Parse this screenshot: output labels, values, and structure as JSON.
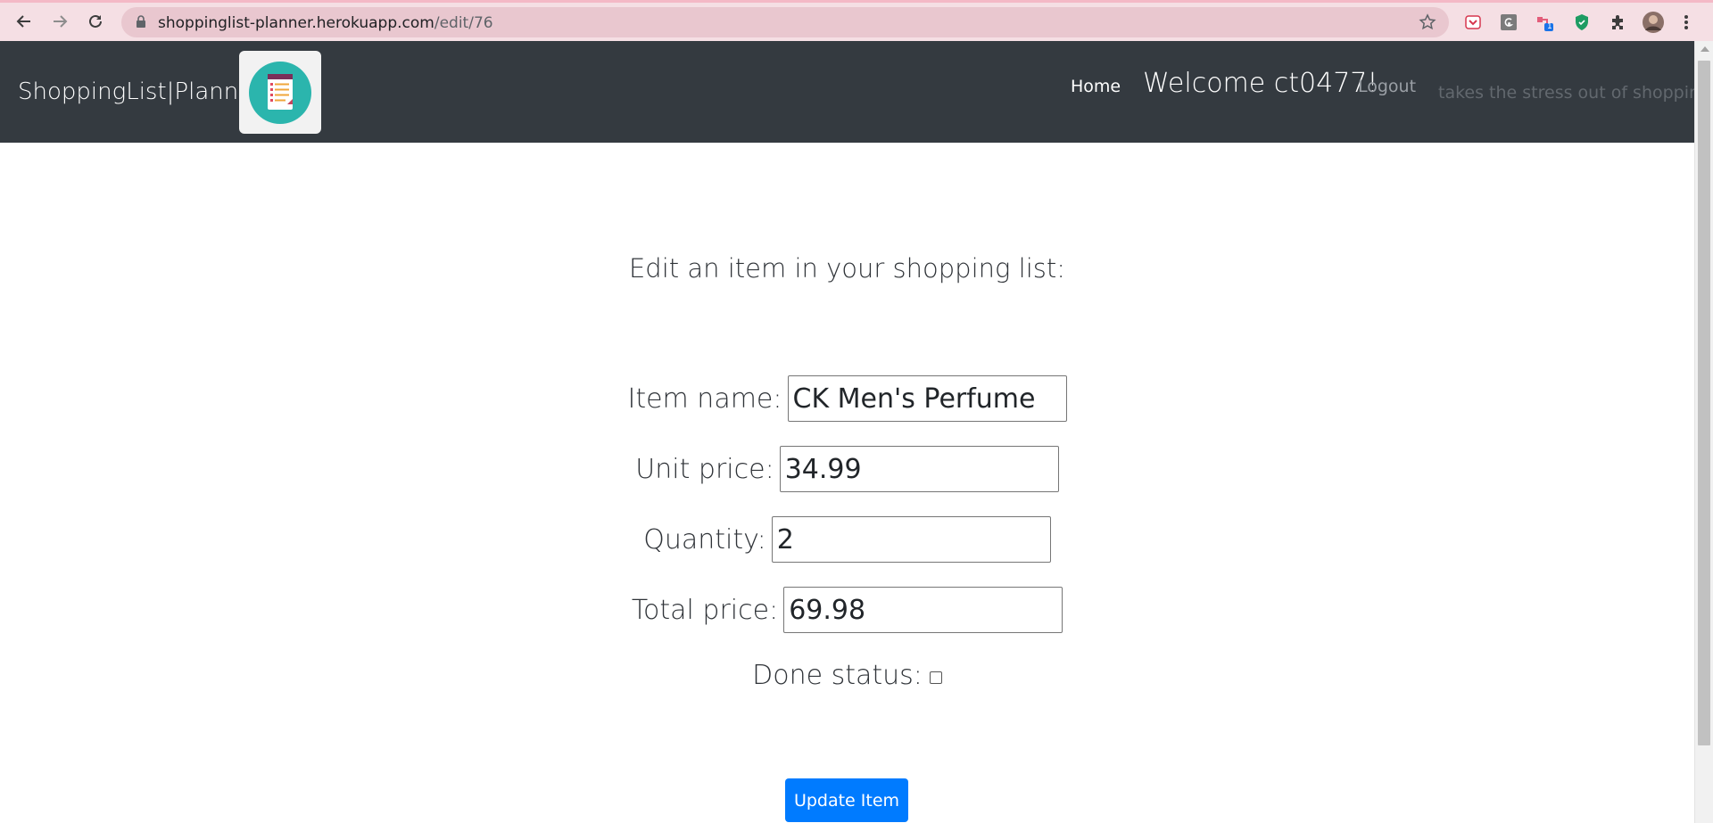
{
  "browser": {
    "url_host": "shoppinglist-planner.herokuapp.com",
    "url_path": "/edit/76",
    "extension_badge": "1"
  },
  "navbar": {
    "brand": "ShoppingList|Planner",
    "home": "Home",
    "welcome": "Welcome ct0477!",
    "logout": "Logout",
    "tagline": "takes the stress out of shopping"
  },
  "form": {
    "title": "Edit an item in your shopping list:",
    "item_name_label": "Item name:",
    "item_name_value": "CK Men's Perfume",
    "unit_price_label": "Unit price:",
    "unit_price_value": "34.99",
    "quantity_label": "Quantity:",
    "quantity_value": "2",
    "total_price_label": "Total price:",
    "total_price_value": "69.98",
    "done_label": "Done status:",
    "done_checked": false,
    "submit_label": "Update Item"
  },
  "colors": {
    "navbar_bg": "#343a40",
    "button_bg": "#007bff",
    "logo_circle": "#2bb5ad"
  }
}
